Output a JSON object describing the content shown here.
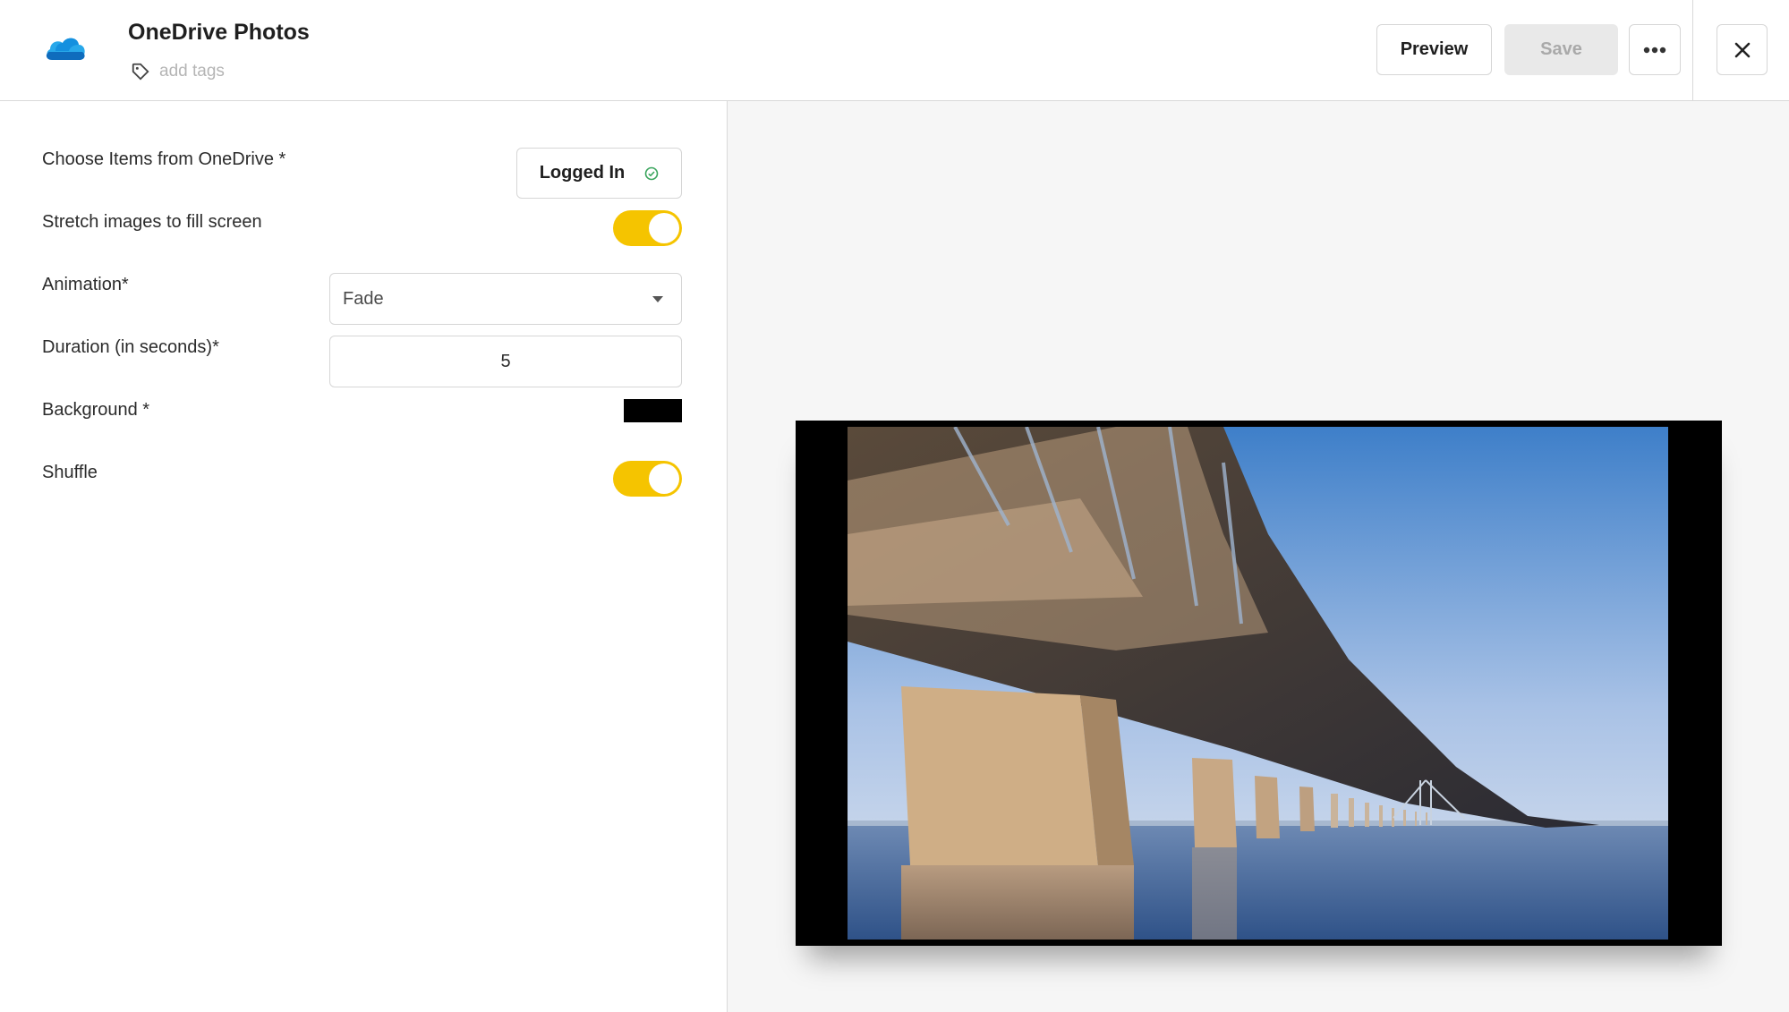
{
  "header": {
    "app_title": "OneDrive Photos",
    "tags_placeholder": "add tags",
    "preview_label": "Preview",
    "save_label": "Save",
    "more_icon": "more-horizontal-icon",
    "close_icon": "close-icon",
    "logo_icon": "onedrive-cloud-icon"
  },
  "form": {
    "source": {
      "label": "Choose Items from OneDrive *",
      "status": "Logged In",
      "status_icon": "check-circle-icon"
    },
    "stretch": {
      "label": "Stretch images to fill screen",
      "enabled": true
    },
    "animation": {
      "label": "Animation*",
      "value": "Fade"
    },
    "duration": {
      "label": "Duration (in seconds)*",
      "value": "5"
    },
    "background": {
      "label": "Background *",
      "color": "#000000"
    },
    "shuffle": {
      "label": "Shuffle",
      "enabled": true
    }
  },
  "colors": {
    "accent_toggle": "#f5c400",
    "onedrive_blue": "#0f6cbd",
    "success_green": "#3aa55d"
  },
  "preview": {
    "image_subject": "bridge-over-sea-photo"
  }
}
